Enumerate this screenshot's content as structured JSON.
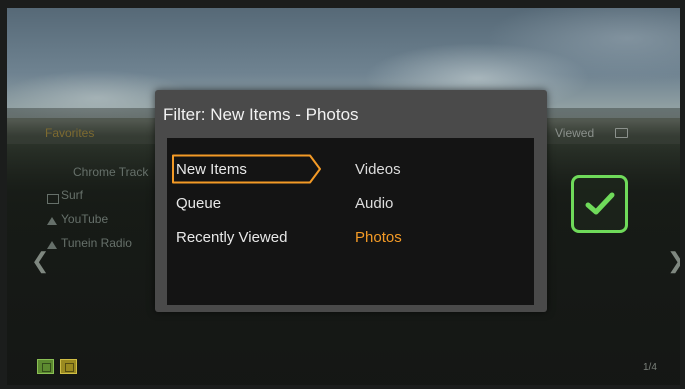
{
  "background": {
    "favorites_label": "Favorites",
    "viewed_label": "Viewed",
    "list_items": [
      "Chrome Track",
      "Surf",
      "YouTube",
      "Tunein Radio"
    ],
    "page_indicator": "1/4"
  },
  "dialog": {
    "title": "Filter: New Items - Photos",
    "filters": [
      "New Items",
      "Queue",
      "Recently Viewed"
    ],
    "selected_filter": "New Items",
    "media_types": [
      "Videos",
      "Audio",
      "Photos"
    ],
    "selected_media_type": "Photos"
  },
  "colors": {
    "accent": "#f39a26",
    "check": "#6fda5a"
  },
  "icons": [
    "check-icon",
    "chevron-left-icon",
    "chevron-right-icon",
    "video-icon",
    "music-icon"
  ]
}
